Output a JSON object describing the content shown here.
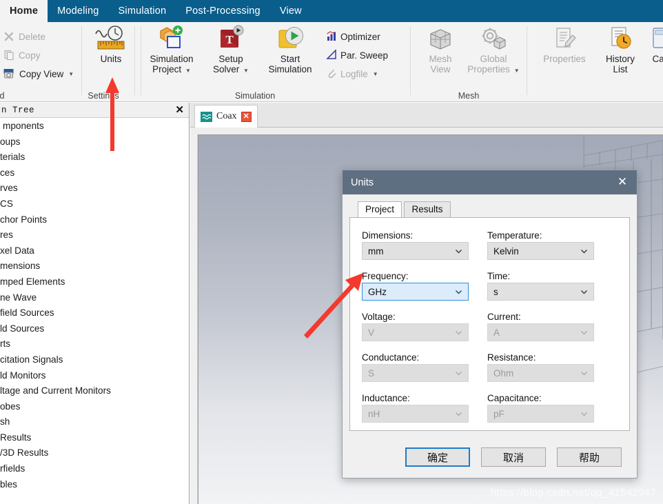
{
  "ribbon": {
    "tabs": [
      {
        "label": "Home",
        "active": true
      },
      {
        "label": "Modeling",
        "active": false
      },
      {
        "label": "Simulation",
        "active": false
      },
      {
        "label": "Post-Processing",
        "active": false
      },
      {
        "label": "View",
        "active": false
      }
    ],
    "groups": {
      "clipboard": {
        "title": "lipboard",
        "items": [
          {
            "label": "Delete",
            "icon": "delete-icon",
            "disabled": true,
            "caret": false
          },
          {
            "label": "Copy",
            "icon": "copy-icon",
            "disabled": true,
            "caret": false
          },
          {
            "label": "Copy View",
            "icon": "copy-view-icon",
            "disabled": false,
            "caret": true
          }
        ]
      },
      "settings": {
        "title": "Settings",
        "items": [
          {
            "label": "Units",
            "icon": "units-ruler-clock-icon"
          }
        ]
      },
      "simulation": {
        "title": "Simulation",
        "big_items": [
          {
            "line1": "Simulation",
            "line2": "Project",
            "icon": "simulation-project-icon",
            "caret": true
          },
          {
            "line1": "Setup",
            "line2": "Solver",
            "icon": "setup-solver-icon",
            "caret": true
          },
          {
            "line1": "Start",
            "line2": "Simulation",
            "icon": "start-simulation-icon",
            "caret": false
          }
        ],
        "small_items": [
          {
            "label": "Optimizer",
            "icon": "optimizer-icon",
            "disabled": false,
            "caret": false
          },
          {
            "label": "Par. Sweep",
            "icon": "par-sweep-icon",
            "disabled": false,
            "caret": false
          },
          {
            "label": "Logfile",
            "icon": "logfile-icon",
            "disabled": true,
            "caret": true
          }
        ]
      },
      "mesh": {
        "title": "Mesh",
        "big_items": [
          {
            "line1": "Mesh",
            "line2": "View",
            "icon": "mesh-view-icon",
            "caret": false,
            "disabled": true
          },
          {
            "line1": "Global",
            "line2": "Properties",
            "icon": "global-properties-icon",
            "caret": true,
            "disabled": true
          }
        ]
      },
      "last": {
        "title": "",
        "big_items": [
          {
            "line1": "Properties",
            "line2": "",
            "icon": "properties-icon",
            "caret": false,
            "disabled": true
          },
          {
            "line1": "History",
            "line2": "List",
            "icon": "history-list-icon",
            "caret": false,
            "disabled": false
          },
          {
            "line1": "Calc",
            "line2": "",
            "icon": "calculator-icon",
            "caret": false,
            "disabled": false
          }
        ]
      }
    }
  },
  "tree_panel": {
    "title": "n Tree",
    "close_glyph": "✕",
    "items": [
      {
        "label": "mponents",
        "selected": true
      },
      {
        "label": "oups",
        "selected": false
      },
      {
        "label": "terials",
        "selected": false
      },
      {
        "label": "ces",
        "selected": false
      },
      {
        "label": "rves",
        "selected": false
      },
      {
        "label": "CS",
        "selected": false
      },
      {
        "label": "chor Points",
        "selected": false
      },
      {
        "label": "res",
        "selected": false
      },
      {
        "label": "xel Data",
        "selected": false
      },
      {
        "label": "mensions",
        "selected": false
      },
      {
        "label": "mped Elements",
        "selected": false
      },
      {
        "label": "ne Wave",
        "selected": false
      },
      {
        "label": "field Sources",
        "selected": false
      },
      {
        "label": "ld Sources",
        "selected": false
      },
      {
        "label": "rts",
        "selected": false
      },
      {
        "label": "citation Signals",
        "selected": false
      },
      {
        "label": "ld Monitors",
        "selected": false
      },
      {
        "label": "ltage and Current Monitors",
        "selected": false
      },
      {
        "label": "obes",
        "selected": false
      },
      {
        "label": "sh",
        "selected": false
      },
      {
        "label": " Results",
        "selected": false
      },
      {
        "label": "/3D Results",
        "selected": false
      },
      {
        "label": "rfields",
        "selected": false
      },
      {
        "label": "bles",
        "selected": false
      }
    ]
  },
  "document_tabs": [
    {
      "label": "Coax",
      "icon": "wave-icon",
      "close_glyph": "✕",
      "active": true
    }
  ],
  "viewport": {
    "watermark": "https://blog.csdn.net/qq_41542947"
  },
  "dialog": {
    "title": "Units",
    "close_glyph": "✕",
    "tabs": [
      {
        "label": "Project",
        "active": true
      },
      {
        "label": "Results",
        "active": false
      }
    ],
    "fields": [
      {
        "label": "Dimensions:",
        "value": "mm",
        "state": "normal"
      },
      {
        "label": "Temperature:",
        "value": "Kelvin",
        "state": "normal"
      },
      {
        "label": "Frequency:",
        "value": "GHz",
        "state": "focused"
      },
      {
        "label": "Time:",
        "value": "s",
        "state": "normal"
      },
      {
        "label": "Voltage:",
        "value": "V",
        "state": "disabled"
      },
      {
        "label": "Current:",
        "value": "A",
        "state": "disabled"
      },
      {
        "label": "Conductance:",
        "value": "S",
        "state": "disabled"
      },
      {
        "label": "Resistance:",
        "value": "Ohm",
        "state": "disabled"
      },
      {
        "label": "Inductance:",
        "value": "nH",
        "state": "disabled"
      },
      {
        "label": "Capacitance:",
        "value": "pF",
        "state": "disabled"
      }
    ],
    "buttons": [
      {
        "label": "确定",
        "default": true
      },
      {
        "label": "取消",
        "default": false
      },
      {
        "label": "帮助",
        "default": false
      }
    ]
  },
  "colors": {
    "ribbon_blue": "#0a5e8c",
    "dialog_titlebar": "#5f6f82",
    "focus_blue": "#2d8fd5",
    "annotation_red": "#f4392e",
    "tab_teal": "#18928b",
    "tab_close_red": "#e8533a"
  }
}
